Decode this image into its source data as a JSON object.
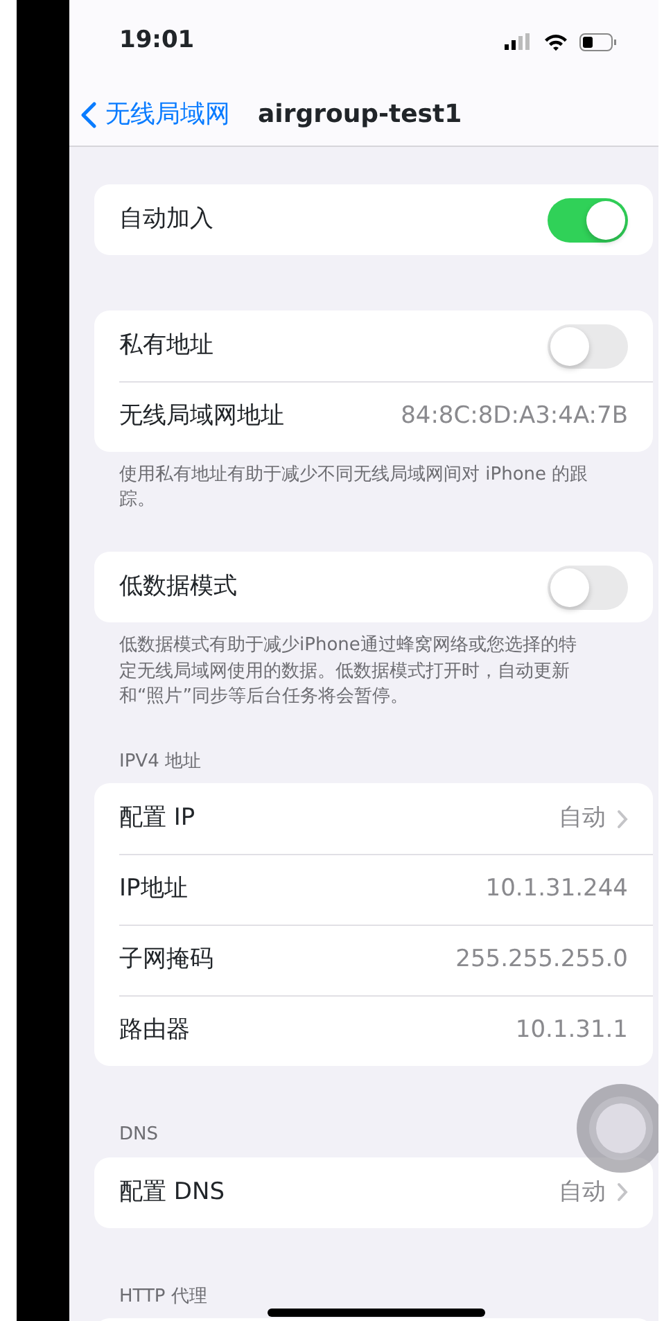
{
  "status_bar": {
    "time": "19:01"
  },
  "nav": {
    "back_label": "无线局域网",
    "title": "airgroup-test1"
  },
  "sections": [
    {
      "rows": [
        {
          "kind": "toggle",
          "label": "自动加入",
          "on": true
        }
      ]
    },
    {
      "rows": [
        {
          "kind": "toggle",
          "label": "私有地址",
          "on": false
        },
        {
          "kind": "value",
          "label": "无线局域网地址",
          "value": "84:8C:8D:A3:4A:7B"
        }
      ],
      "footer": "使用私有地址有助于减少不同无线局域网间对 iPhone 的跟踪。"
    },
    {
      "rows": [
        {
          "kind": "toggle",
          "label": "低数据模式",
          "on": false
        }
      ],
      "footer": "低数据模式有助于减少iPhone通过蜂窝网络或您选择的特定无线局域网使用的数据。低数据模式打开时，自动更新和“照片”同步等后台任务将会暂停。"
    },
    {
      "header": "IPV4 地址",
      "rows": [
        {
          "kind": "link",
          "label": "配置 IP",
          "value": "自动"
        },
        {
          "kind": "value",
          "label": "IP地址",
          "value": "10.1.31.244"
        },
        {
          "kind": "value",
          "label": "子网掩码",
          "value": "255.255.255.0"
        },
        {
          "kind": "value",
          "label": "路由器",
          "value": "10.1.31.1"
        }
      ]
    },
    {
      "header": "DNS",
      "rows": [
        {
          "kind": "link",
          "label": "配置 DNS",
          "value": "自动"
        }
      ]
    },
    {
      "header": "HTTP 代理"
    }
  ]
}
